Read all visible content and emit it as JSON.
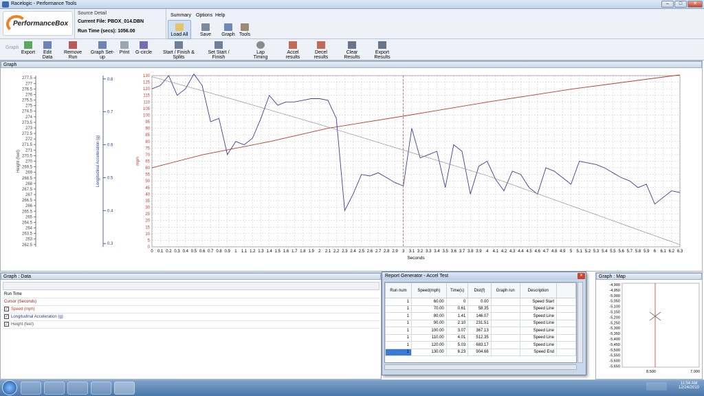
{
  "window": {
    "title": "Racelogic - Performance Tools",
    "min": "–",
    "max": "□",
    "close": "✕"
  },
  "header": {
    "logo_text": "PerformanceBox",
    "source_heading": "Source Detail",
    "current_file": "Current File:  PBOX_014.DBN",
    "run_time": "Run Time (secs):  1056.00"
  },
  "menu": [
    "Summary",
    "Options",
    "Help"
  ],
  "ribbon": [
    {
      "label": "Load All",
      "icon": "folder-icon"
    },
    {
      "label": "Save",
      "icon": "save-icon"
    },
    {
      "label": "Graph",
      "icon": "graph-icon"
    },
    {
      "label": "Tools",
      "icon": "tools-icon"
    }
  ],
  "toolbar": [
    "Graph",
    "Export",
    "Edit Data",
    "Remove Run",
    "Graph Set-up",
    "Print",
    "G-circle",
    "Start / Finish & Splits",
    "Set Start / Finish",
    "Lap Timing",
    "Accel results",
    "Decel results",
    "Clear Results",
    "Export Results"
  ],
  "graph_panel": {
    "title": "Graph"
  },
  "chart_data": {
    "type": "line",
    "xlabel": "Seconds",
    "xlim": [
      0,
      6.3
    ],
    "x_ticks": [
      "0",
      "0.1",
      "0.2",
      "0.3",
      "0.4",
      "0.5",
      "0.6",
      "0.7",
      "0.8",
      "0.9",
      "1",
      "1.1",
      "1.2",
      "1.3",
      "1.4",
      "1.5",
      "1.6",
      "1.7",
      "1.8",
      "1.9",
      "2",
      "2.1",
      "2.2",
      "2.3",
      "2.4",
      "2.5",
      "2.6",
      "2.7",
      "2.8",
      "2.9",
      "3",
      "3.1",
      "3.2",
      "3.3",
      "3.4",
      "3.5",
      "3.6",
      "3.7",
      "3.8",
      "3.9",
      "4",
      "4.1",
      "4.2",
      "4.3",
      "4.4",
      "4.5",
      "4.6",
      "4.7",
      "4.8",
      "4.9",
      "5",
      "5.1",
      "5.2",
      "5.3",
      "5.4",
      "5.5",
      "5.6",
      "5.7",
      "5.8",
      "5.9",
      "6",
      "6.1",
      "6.2",
      "6.3"
    ],
    "axes": [
      {
        "label": "mph",
        "ticks": [
          "0",
          "5",
          "10",
          "15",
          "20",
          "25",
          "30",
          "35",
          "40",
          "45",
          "50",
          "55",
          "60",
          "65",
          "70",
          "75",
          "80",
          "85",
          "90",
          "95",
          "100",
          "105",
          "110",
          "115",
          "120",
          "125",
          "130"
        ],
        "range": [
          0,
          130
        ],
        "color": "#c0392b"
      },
      {
        "label": "Longitudinal Acceleration (g)",
        "ticks": [
          "0.3",
          "0.4",
          "0.5",
          "0.6",
          "0.7",
          "0.8"
        ],
        "range": [
          0.29,
          0.81
        ],
        "color": "#2c3e8f"
      },
      {
        "label": "Height (feet)",
        "ticks": [
          "262.5",
          "263",
          "263.5",
          "264",
          "264.5",
          "265",
          "265.5",
          "266",
          "266.5",
          "267",
          "267.5",
          "268",
          "268.5",
          "269",
          "269.5",
          "270",
          "270.5",
          "271",
          "271.5",
          "272",
          "272.5",
          "273",
          "273.5",
          "274",
          "274.5",
          "275",
          "275.5",
          "276",
          "276.5",
          "277",
          "277.5"
        ],
        "range": [
          262.3,
          277.7
        ],
        "color": "#555555"
      }
    ],
    "cursor_x": 3,
    "series": [
      {
        "name": "Speed (mph)",
        "axis": 0,
        "color": "#c0392b",
        "x": [
          0,
          0.61,
          1.41,
          2.1,
          3.07,
          4.01,
          5.03,
          6.23,
          6.3
        ],
        "y": [
          60,
          70,
          80,
          90,
          100,
          110,
          120,
          130,
          130.5
        ]
      },
      {
        "name": "Longitudinal Acceleration (g)",
        "axis": 1,
        "color": "#3a3f9a",
        "x": [
          0,
          0.1,
          0.2,
          0.3,
          0.4,
          0.5,
          0.6,
          0.7,
          0.8,
          0.9,
          1,
          1.1,
          1.2,
          1.3,
          1.4,
          1.5,
          1.6,
          1.7,
          1.8,
          1.9,
          2,
          2.1,
          2.2,
          2.3,
          2.4,
          2.5,
          2.6,
          2.7,
          2.8,
          2.9,
          3,
          3.1,
          3.2,
          3.3,
          3.4,
          3.5,
          3.6,
          3.7,
          3.8,
          3.9,
          4,
          4.1,
          4.2,
          4.3,
          4.4,
          4.5,
          4.6,
          4.7,
          4.8,
          4.9,
          5,
          5.1,
          5.2,
          5.3,
          5.4,
          5.5,
          5.6,
          5.7,
          5.8,
          5.9,
          6,
          6.1,
          6.2,
          6.3
        ],
        "y": [
          0.77,
          0.78,
          0.81,
          0.75,
          0.77,
          0.815,
          0.78,
          0.67,
          0.68,
          0.57,
          0.61,
          0.6,
          0.62,
          0.68,
          0.75,
          0.72,
          0.73,
          0.73,
          0.735,
          0.74,
          0.74,
          0.735,
          0.68,
          0.4,
          0.45,
          0.51,
          0.505,
          0.515,
          0.5,
          0.485,
          0.475,
          0.65,
          0.56,
          0.57,
          0.58,
          0.47,
          0.6,
          0.58,
          0.45,
          0.535,
          0.55,
          0.495,
          0.46,
          0.52,
          0.51,
          0.47,
          0.45,
          0.53,
          0.52,
          0.5,
          0.48,
          0.55,
          0.545,
          0.54,
          0.53,
          0.515,
          0.5,
          0.49,
          0.47,
          0.48,
          0.42,
          0.44,
          0.46,
          0.455
        ]
      },
      {
        "name": "Height (feet)",
        "axis": 2,
        "color": "#888888",
        "x": [
          0,
          1,
          2,
          3,
          4,
          5,
          6,
          6.3
        ],
        "y": [
          277.6,
          275.5,
          273.3,
          271,
          268.7,
          266,
          263.3,
          262.5
        ]
      }
    ]
  },
  "data_panel": {
    "title": "Graph : Data",
    "rows": [
      "Run Time",
      "Cursor (Seconds)",
      "Speed (mph)",
      "Longitudinal Acceleration (g)",
      "Height (feet)"
    ]
  },
  "report": {
    "title": "Report Generator - Accel Test",
    "close": "✕",
    "columns": [
      "Run num",
      "Speed(mph)",
      "Time(s)",
      "Dist(f)",
      "Graph run",
      "Description"
    ],
    "rows": [
      [
        "1",
        "60.00",
        "0",
        "0.00",
        "",
        "Speed Start"
      ],
      [
        "1",
        "70.00",
        "0.61",
        "58.35",
        "",
        "Speed Line"
      ],
      [
        "1",
        "80.00",
        "1.41",
        "146.07",
        "",
        "Speed Line"
      ],
      [
        "1",
        "90.00",
        "2.10",
        "231.51",
        "",
        "Speed Line"
      ],
      [
        "1",
        "100.00",
        "3.07",
        "367.13",
        "",
        "Speed Line"
      ],
      [
        "1",
        "110.00",
        "4.01",
        "512.35",
        "",
        "Speed Line"
      ],
      [
        "1",
        "120.00",
        "5.03",
        "683.17",
        "",
        "Speed Line"
      ],
      [
        "1",
        "130.00",
        "6.23",
        "904.66",
        "",
        "Speed End"
      ]
    ]
  },
  "map_panel": {
    "title": "Graph : Map",
    "y_ticks": [
      "-4,900",
      "-4,950",
      "-5,000",
      "-5,050",
      "-5,100",
      "-5,150",
      "-5,200",
      "-5,250",
      "-5,300",
      "-5,350",
      "-5,400",
      "-5,450",
      "-5,500",
      "-5,550",
      "-5,600",
      "-5,650"
    ],
    "x_ticks": [
      "8,500",
      "7,000"
    ]
  },
  "taskbar": {
    "time": "11:54 AM",
    "date": "12/24/2010"
  }
}
